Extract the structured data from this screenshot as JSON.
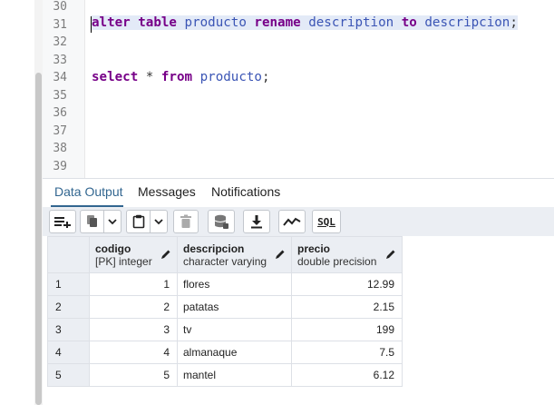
{
  "editor": {
    "line_numbers": [
      "30",
      "31",
      "32",
      "33",
      "34",
      "35",
      "36",
      "37",
      "38",
      "39"
    ],
    "alter_kw1": "alter",
    "alter_kw2": "table",
    "alter_table": "producto",
    "alter_kw3": "rename",
    "alter_old": "description",
    "alter_kw4": "to",
    "alter_new": "descripcion",
    "alter_semi": ";",
    "select_kw": "select",
    "select_star": "*",
    "select_from": "from",
    "select_table": "producto",
    "select_semi": ";"
  },
  "tabs": {
    "data_output": "Data Output",
    "messages": "Messages",
    "notifications": "Notifications"
  },
  "toolbar": {
    "icons": [
      "add-row-icon",
      "copy-icon",
      "chevron-down-icon",
      "paste-icon",
      "chevron-down-icon",
      "delete-icon",
      "save-data-icon",
      "download-icon",
      "graph-icon",
      "sql-icon"
    ],
    "sql_label": "SQL"
  },
  "grid": {
    "columns": [
      {
        "name": "codigo",
        "type": "[PK] integer"
      },
      {
        "name": "descripcion",
        "type": "character varying"
      },
      {
        "name": "precio",
        "type": "double precision"
      }
    ],
    "rows": [
      {
        "n": "1",
        "codigo": "1",
        "descripcion": "flores",
        "precio": "12.99"
      },
      {
        "n": "2",
        "codigo": "2",
        "descripcion": "patatas",
        "precio": "2.15"
      },
      {
        "n": "3",
        "codigo": "3",
        "descripcion": "tv",
        "precio": "199"
      },
      {
        "n": "4",
        "codigo": "4",
        "descripcion": "almanaque",
        "precio": "7.5"
      },
      {
        "n": "5",
        "codigo": "5",
        "descripcion": "mantel",
        "precio": "6.12"
      }
    ]
  },
  "colors": {
    "keyword": "#770088",
    "identifier": "#3b55b5",
    "active_tab": "#326690",
    "header_bg": "#ebeef3"
  }
}
